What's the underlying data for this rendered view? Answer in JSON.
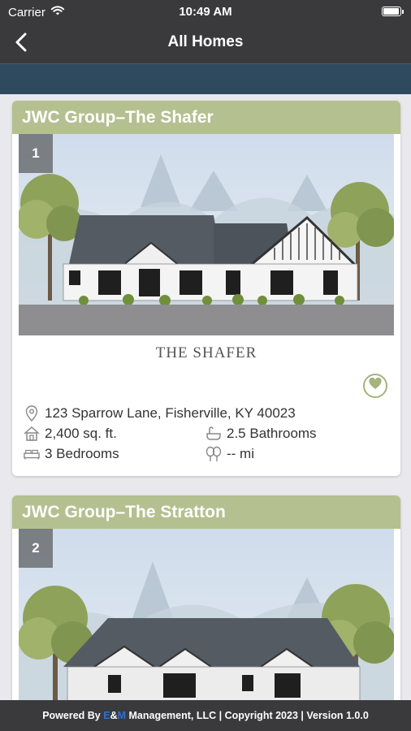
{
  "status": {
    "carrier": "Carrier",
    "time": "10:49 AM"
  },
  "nav": {
    "title": "All Homes"
  },
  "homes": [
    {
      "index": "1",
      "title": "JWC Group–The Shafer",
      "caption": "THE SHAFER",
      "address": "123 Sparrow Lane, Fisherville, KY 40023",
      "sqft": "2,400 sq. ft.",
      "bathrooms": "2.5 Bathrooms",
      "bedrooms": "3 Bedrooms",
      "distance": "-- mi"
    },
    {
      "index": "2",
      "title": "JWC Group–The Stratton"
    }
  ],
  "footer": {
    "prefix": "Powered By ",
    "brand_e": "E",
    "brand_amp": "&",
    "brand_m": "M",
    "suffix": " Management, LLC | Copyright 2023 | Version 1.0.0"
  },
  "colors": {
    "bar": "#3a3a3c",
    "sub_bar": "#2f4a5f",
    "card_header": "#b4c08f",
    "favorite": "#a4b47c"
  },
  "icons": [
    "back-chevron-icon",
    "wifi-icon",
    "battery-icon",
    "heart-icon",
    "location-pin-icon",
    "house-icon",
    "bathtub-icon",
    "bed-icon",
    "trees-icon"
  ]
}
